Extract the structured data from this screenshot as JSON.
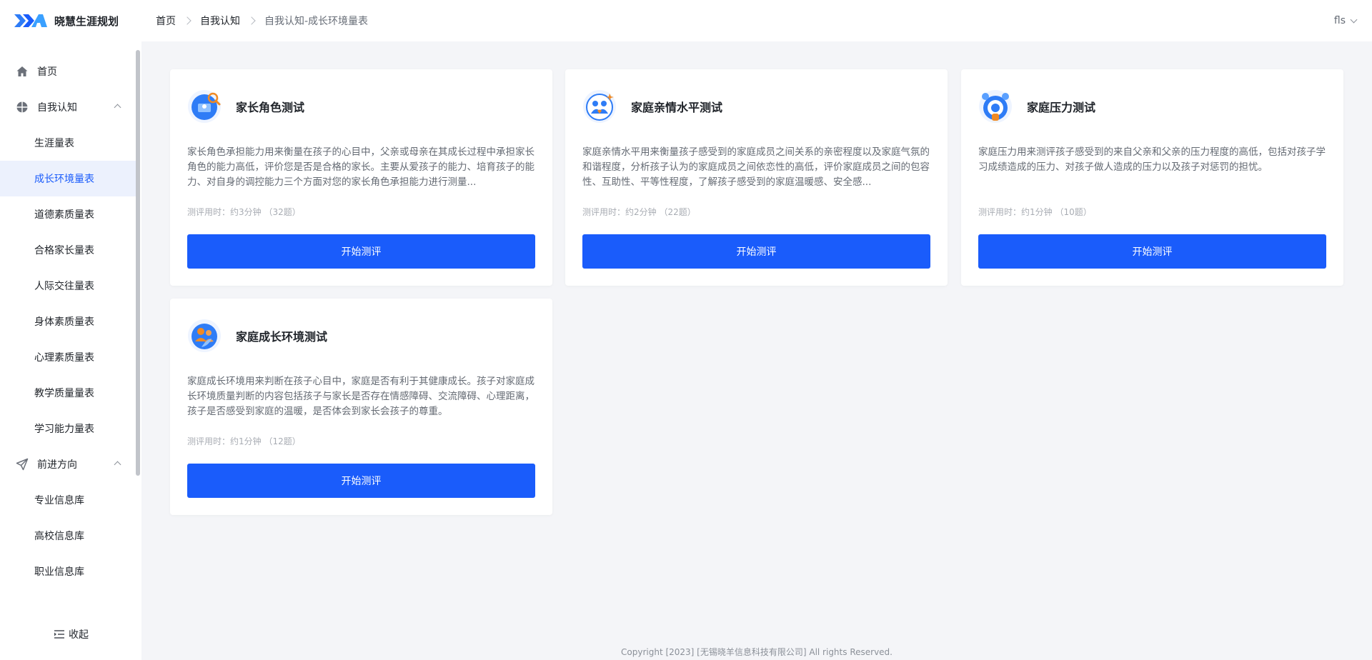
{
  "app": {
    "name": "晓慧生涯规划"
  },
  "breadcrumb": [
    "首页",
    "自我认知",
    "自我认知-成长环境量表"
  ],
  "user": {
    "name": "fls"
  },
  "sidebar": {
    "home": "首页",
    "group1": {
      "label": "自我认知",
      "items": [
        "生涯量表",
        "成长环境量表",
        "道德素质量表",
        "合格家长量表",
        "人际交往量表",
        "身体素质量表",
        "心理素质量表",
        "教学质量量表",
        "学习能力量表"
      ]
    },
    "group2": {
      "label": "前进方向",
      "items": [
        "专业信息库",
        "高校信息库",
        "职业信息库"
      ]
    },
    "collapse": "收起"
  },
  "cards": [
    {
      "title": "家长角色测试",
      "desc": "家长角色承担能力用来衡量在孩子的心目中，父亲或母亲在其成长过程中承担家长角色的能力高低，评价您是否是合格的家长。主要从爱孩子的能力、培育孩子的能力、对自身的调控能力三个方面对您的家长角色承担能力进行测量...",
      "meta": "测评用时：约3分钟 （32题）",
      "button": "开始测评"
    },
    {
      "title": "家庭亲情水平测试",
      "desc": "家庭亲情水平用来衡量孩子感受到的家庭成员之间关系的亲密程度以及家庭气氛的和谐程度，分析孩子认为的家庭成员之间依恋性的高低，评价家庭成员之间的包容性、互助性、平等性程度，了解孩子感受到的家庭温暖感、安全感...",
      "meta": "测评用时：约2分钟 （22题）",
      "button": "开始测评"
    },
    {
      "title": "家庭压力测试",
      "desc": "家庭压力用来测评孩子感受到的来自父亲和父亲的压力程度的高低，包括对孩子学习成绩造成的压力、对孩子做人造成的压力以及孩子对惩罚的担忧。",
      "meta": "测评用时：约1分钟 （10题）",
      "button": "开始测评"
    },
    {
      "title": "家庭成长环境测试",
      "desc": "家庭成长环境用来判断在孩子心目中，家庭是否有利于其健康成长。孩子对家庭成长环境质量判断的内容包括孩子与家长是否存在情感障碍、交流障碍、心理距离，孩子是否感受到家庭的温暖，是否体会到家长会孩子的尊重。",
      "meta": "测评用时：约1分钟 （12题）",
      "button": "开始测评"
    }
  ],
  "footer": "Copyright [2023] [无锡晓羊信息科技有限公司] All rights Reserved.",
  "colors": {
    "primary": "#1a5cfb",
    "active_bg": "#ecf1fd"
  }
}
